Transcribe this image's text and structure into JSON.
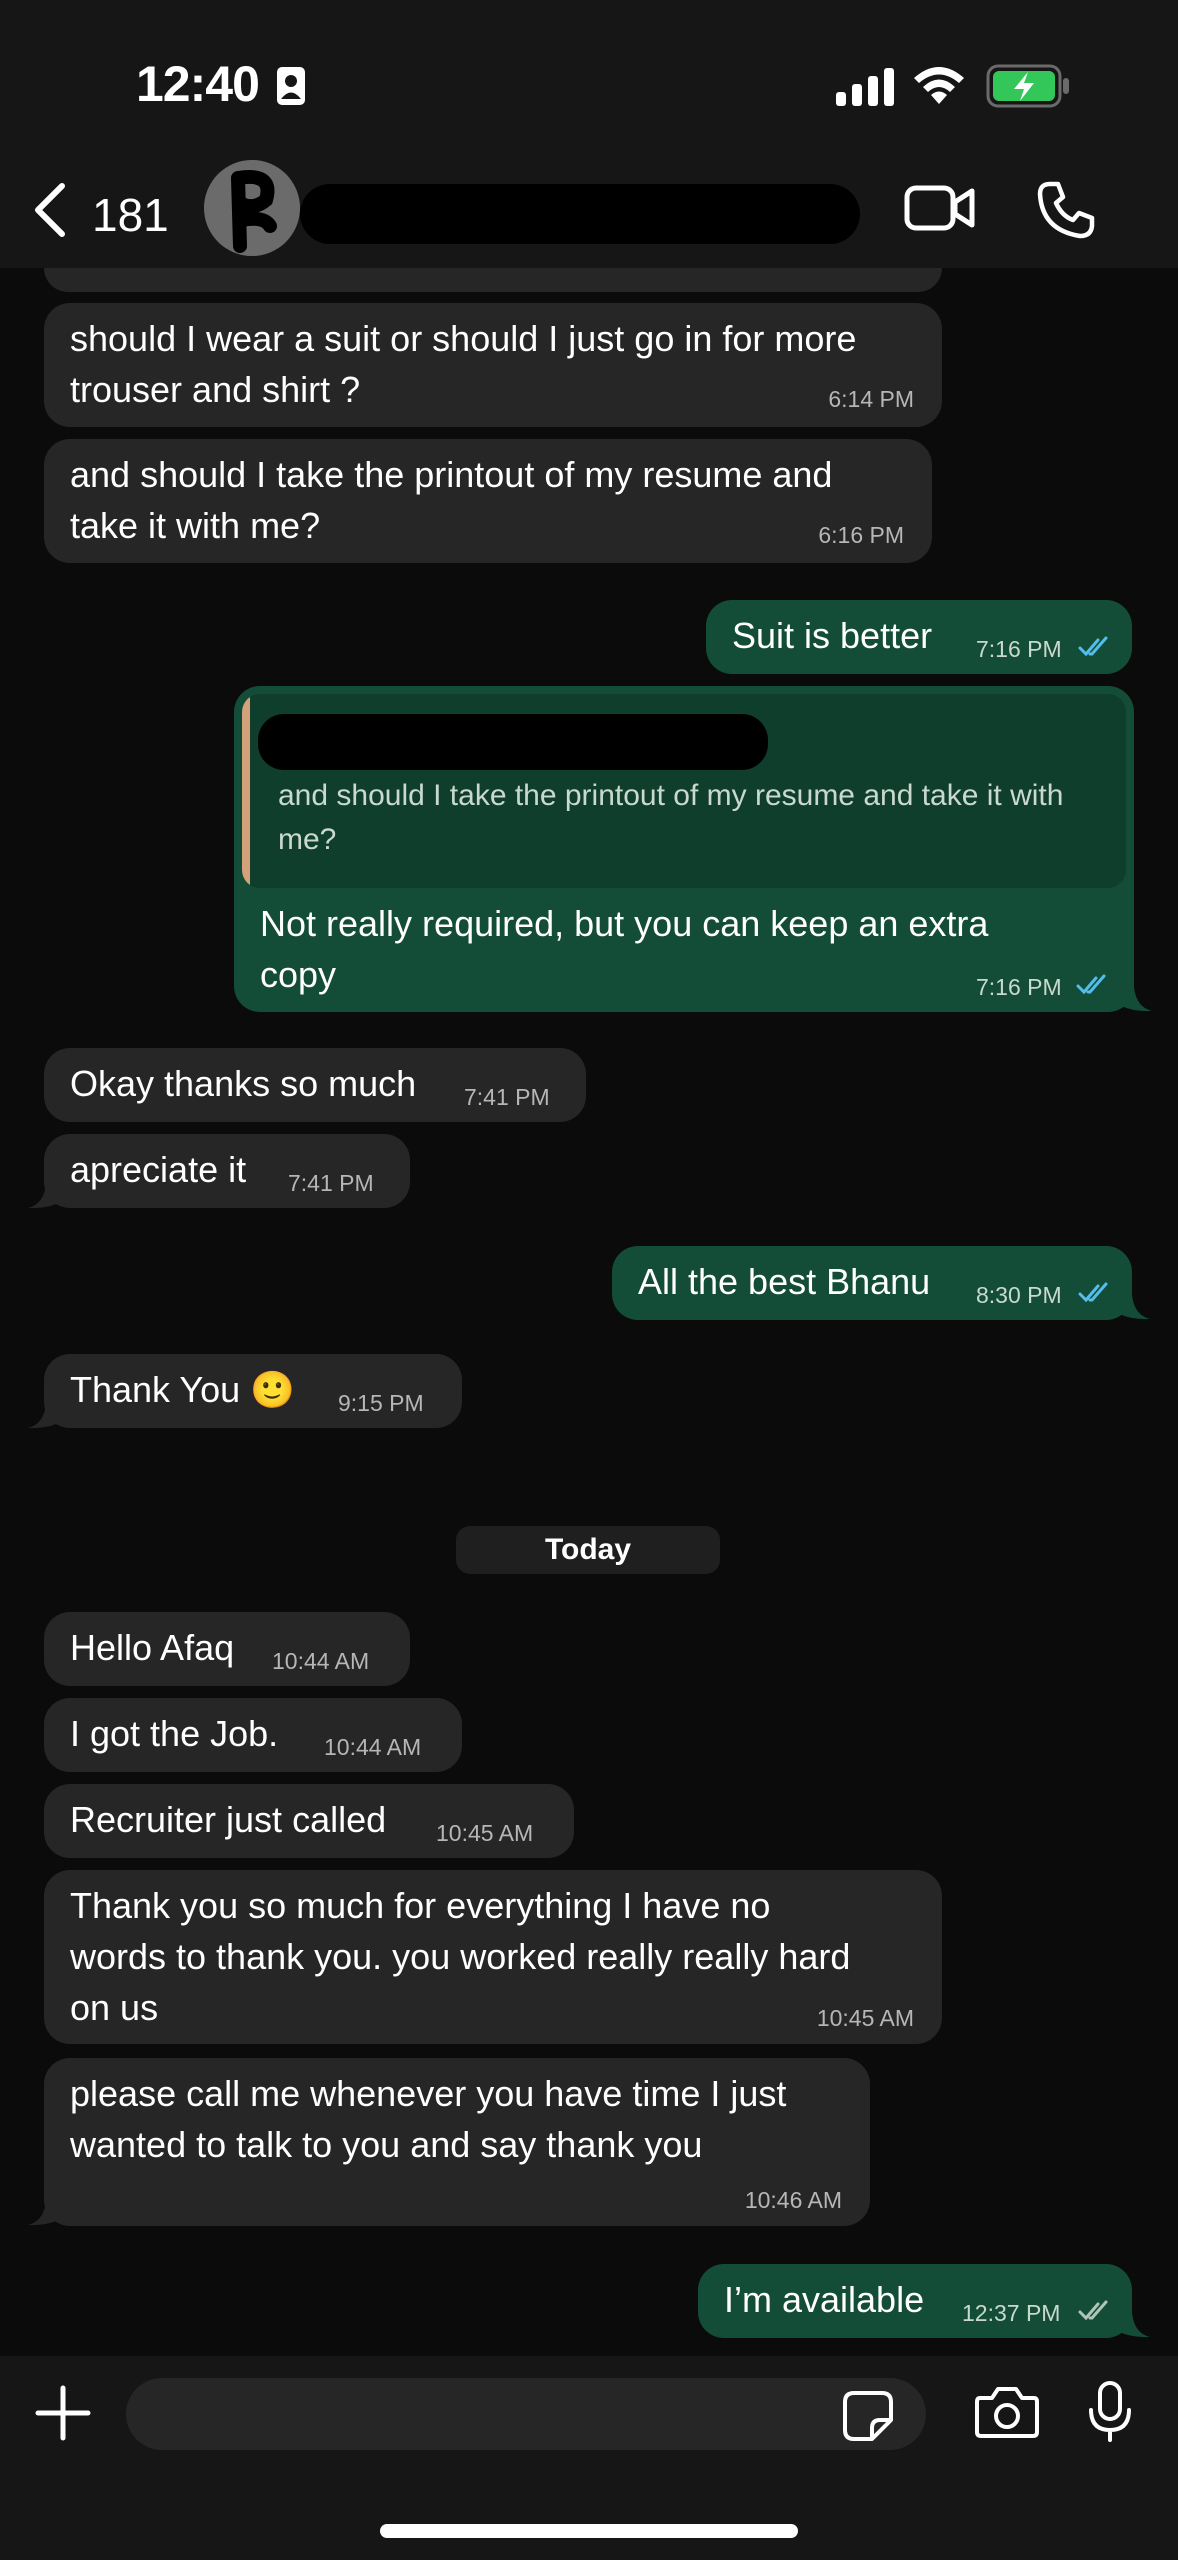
{
  "status_bar": {
    "time": "12:40"
  },
  "header": {
    "back_count": "181"
  },
  "date_separator": "Today",
  "messages": [
    {
      "dir": "in",
      "text": "should I wear a suit or should I just go in for more\ntrouser and shirt ?",
      "time": "6:14 PM"
    },
    {
      "dir": "in",
      "text": "and should I take the printout of my resume and\ntake it with me?",
      "time": "6:16 PM"
    },
    {
      "dir": "out",
      "text": "Suit is better",
      "time": "7:16 PM"
    },
    {
      "dir": "out",
      "text": "Not really required, but you can keep an extra\ncopy",
      "time": "7:16 PM",
      "quoted": "and should I take the printout of my resume and take it with me?"
    },
    {
      "dir": "in",
      "text": "Okay thanks so much",
      "time": "7:41 PM"
    },
    {
      "dir": "in",
      "text": "apreciate it",
      "time": "7:41 PM"
    },
    {
      "dir": "out",
      "text": "All the best Bhanu",
      "time": "8:30 PM"
    },
    {
      "dir": "in",
      "text": "Thank You 🙂",
      "time": "9:15 PM"
    },
    {
      "dir": "in",
      "text": "Hello Afaq",
      "time": "10:44 AM"
    },
    {
      "dir": "in",
      "text": "I got the Job.",
      "time": "10:44 AM"
    },
    {
      "dir": "in",
      "text": "Recruiter just called",
      "time": "10:45 AM"
    },
    {
      "dir": "in",
      "text": "Thank you so much for everything I have no\nwords to thank you. you worked really really hard\non us",
      "time": "10:45 AM"
    },
    {
      "dir": "in",
      "text": "please call me whenever you have time I just\nwanted to talk to you and say thank you",
      "time": "10:46 AM"
    },
    {
      "dir": "out",
      "text": "I’m available",
      "time": "12:37 PM"
    }
  ],
  "composer": {
    "placeholder": ""
  },
  "icons": {
    "back": "chevron-left-icon",
    "video": "video-call-icon",
    "phone": "phone-call-icon",
    "add": "plus-icon",
    "sticker": "sticker-icon",
    "camera": "camera-icon",
    "mic": "microphone-icon",
    "ticks": "double-check-icon"
  },
  "colors": {
    "incoming": "#262626",
    "outgoing": "#144d37",
    "read_ticks": "#53bdeb",
    "background": "#0b0b0b"
  }
}
